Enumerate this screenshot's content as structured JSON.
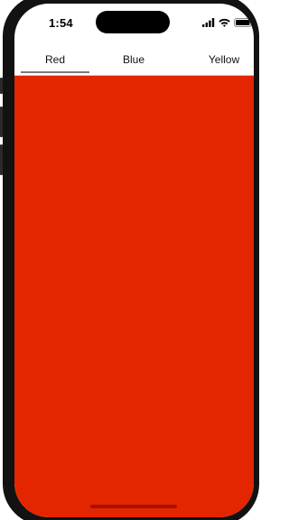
{
  "status_bar": {
    "time": "1:54"
  },
  "tabs": [
    {
      "label": "Red",
      "selected": true,
      "color": "#e32500"
    },
    {
      "label": "Blue",
      "selected": false,
      "color": "#1e5be3"
    },
    {
      "label": "Yellow",
      "selected": false,
      "color": "#f2d600"
    }
  ],
  "content": {
    "background_color": "#e32500"
  },
  "colors": {
    "indicator": "#7a7a7a",
    "phone_frame": "#121212"
  },
  "icons": [
    "cellular-signal-icon",
    "wifi-icon",
    "battery-icon"
  ]
}
